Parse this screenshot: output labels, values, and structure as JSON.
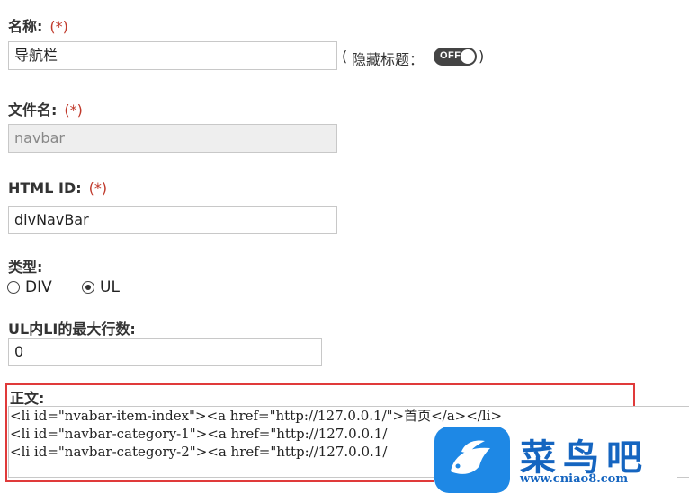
{
  "form": {
    "name": {
      "label": "名称:",
      "required": "(*)",
      "value": "导航栏"
    },
    "hide_title": {
      "open": "(",
      "label": "隐藏标题：",
      "toggle_text": "OFF",
      "close": ")"
    },
    "filename": {
      "label": "文件名:",
      "required": "(*)",
      "value": "navbar"
    },
    "html_id": {
      "label": "HTML ID:",
      "required": "(*)",
      "value": "divNavBar"
    },
    "type": {
      "label": "类型:",
      "options": [
        "DIV",
        "UL"
      ],
      "selected": "UL"
    },
    "max_rows": {
      "label": "UL内LI的最大行数:",
      "value": "0"
    },
    "body": {
      "label": "正文:",
      "lines": [
        "<li id=\"nvabar-item-index\"><a href=\"http://127.0.0.1/\">首页</a></li>",
        "<li id=\"navbar-category-1\"><a href=\"http://127.0.0.1/",
        "<li id=\"navbar-category-2\"><a href=\"http://127.0.0.1/"
      ]
    }
  },
  "watermark": {
    "name": "菜鸟吧",
    "url": "www.cniao8.com"
  },
  "colors": {
    "required": "#c0392b",
    "highlight": "#e03a3a",
    "brand": "#1e88e5"
  }
}
